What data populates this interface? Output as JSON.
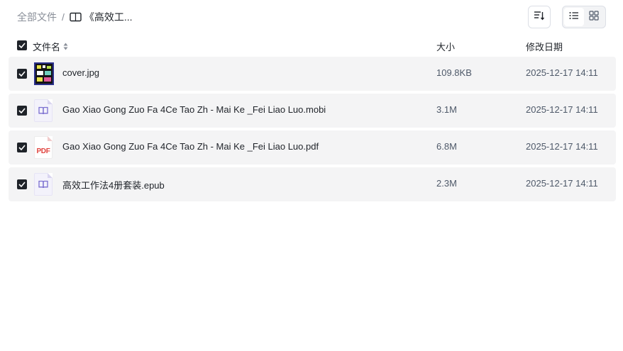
{
  "breadcrumb": {
    "root": "全部文件",
    "separator": "/",
    "current": "《高效工..."
  },
  "toolbar": {
    "sort_icon": "sort-icon",
    "list_view_icon": "list-view-icon",
    "grid_view_icon": "grid-view-icon",
    "active_view": "list"
  },
  "table": {
    "headers": {
      "name": "文件名",
      "size": "大小",
      "date": "修改日期"
    },
    "select_all_checked": true,
    "rows": [
      {
        "name": "cover.jpg",
        "size": "109.8KB",
        "date": "2025-12-17 14:11",
        "icon": "image-thumbnail",
        "checked": true
      },
      {
        "name": "Gao Xiao Gong Zuo Fa 4Ce Tao Zh - Mai Ke _Fei Liao Luo.mobi",
        "size": "3.1M",
        "date": "2025-12-17 14:11",
        "icon": "ebook-file-icon",
        "checked": true
      },
      {
        "name": "Gao Xiao Gong Zuo Fa 4Ce Tao Zh - Mai Ke _Fei Liao Luo.pdf",
        "size": "6.8M",
        "date": "2025-12-17 14:11",
        "icon": "pdf-file-icon",
        "pdf_label": "PDF",
        "checked": true
      },
      {
        "name": "高效工作法4册套装.epub",
        "size": "2.3M",
        "date": "2025-12-17 14:11",
        "icon": "ebook-file-icon",
        "checked": true
      }
    ]
  },
  "colors": {
    "checkbox": "#1f2329",
    "row_bg": "#f4f4f5",
    "ebook_accent": "#7b6fd0",
    "pdf_red": "#e0433e"
  }
}
